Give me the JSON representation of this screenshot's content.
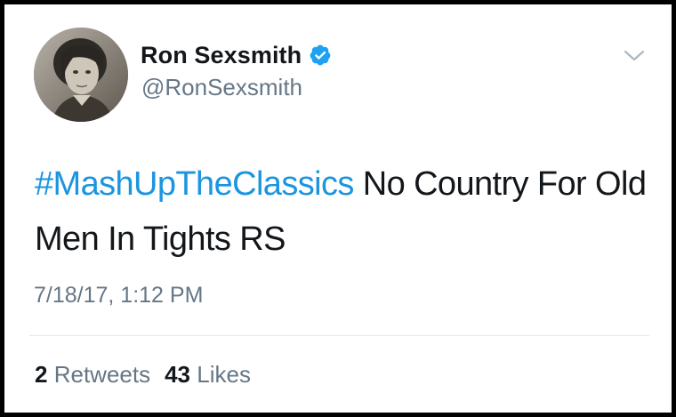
{
  "author": {
    "display_name": "Ron Sexsmith",
    "handle": "@RonSexsmith",
    "verified": true,
    "avatar_icon": "user-avatar-photo"
  },
  "tweet": {
    "hashtag": "#MashUpTheClassics",
    "text": " No Country For Old Men In Tights RS",
    "timestamp": "7/18/17, 1:12 PM"
  },
  "stats": {
    "retweets_count": "2",
    "retweets_label": "Retweets",
    "likes_count": "43",
    "likes_label": "Likes"
  },
  "icons": {
    "verified": "verified-badge-icon",
    "menu": "chevron-down-icon"
  },
  "colors": {
    "hashtag": "#1b95e0",
    "verified_badge": "#1da1f2",
    "secondary_text": "#657786",
    "primary_text": "#14171a",
    "divider": "#e1e8ed",
    "border": "#000000"
  }
}
